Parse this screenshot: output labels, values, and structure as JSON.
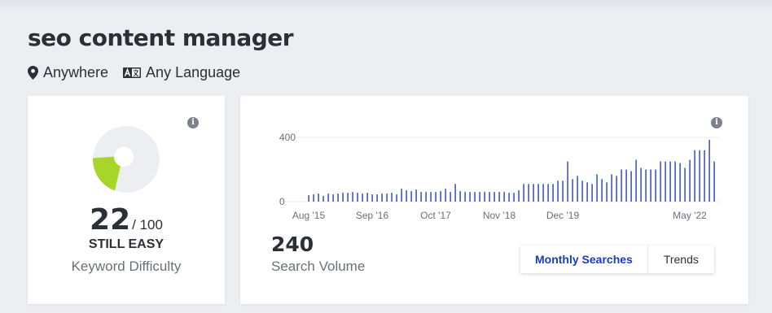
{
  "header": {
    "title": "seo content manager",
    "location": "Anywhere",
    "language": "Any Language"
  },
  "keyword_difficulty": {
    "score": "22",
    "out_of": "/ 100",
    "difficulty_label": "STILL EASY",
    "caption": "Keyword Difficulty",
    "score_fraction": 0.22,
    "colors": {
      "fill": "#a6d629",
      "track": "#eceef1"
    }
  },
  "search_volume": {
    "value": "240",
    "caption": "Search Volume",
    "tabs": [
      "Monthly Searches",
      "Trends"
    ],
    "active_tab": "Monthly Searches"
  },
  "chart_data": {
    "type": "bar",
    "title": "",
    "y_ticks": [
      "400",
      "0"
    ],
    "ylim": [
      0,
      400
    ],
    "x_tick_labels": [
      "Aug '15",
      "Sep '16",
      "Oct '17",
      "Nov '18",
      "Dec '19",
      "May '22"
    ],
    "x_tick_positions": [
      0,
      13,
      26,
      39,
      52,
      78
    ],
    "bar_color": "#2541b2",
    "values": [
      40,
      45,
      50,
      35,
      50,
      45,
      50,
      55,
      55,
      60,
      55,
      50,
      55,
      45,
      45,
      50,
      50,
      55,
      45,
      80,
      70,
      65,
      75,
      60,
      60,
      60,
      60,
      65,
      80,
      60,
      110,
      65,
      60,
      60,
      60,
      60,
      60,
      60,
      60,
      60,
      60,
      55,
      55,
      70,
      110,
      110,
      110,
      110,
      110,
      110,
      110,
      130,
      130,
      250,
      140,
      160,
      130,
      120,
      110,
      170,
      140,
      120,
      170,
      160,
      200,
      200,
      190,
      260,
      210,
      200,
      200,
      200,
      250,
      250,
      250,
      250,
      240,
      210,
      260,
      320,
      320,
      320,
      385,
      250
    ]
  }
}
